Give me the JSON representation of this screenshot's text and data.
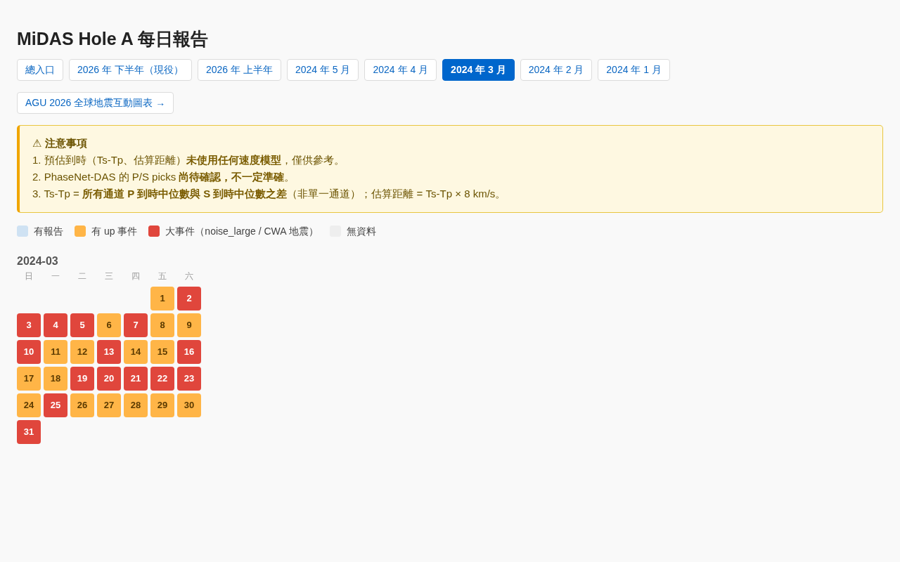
{
  "title": "MiDAS Hole A 每日報告",
  "nav": [
    {
      "label": "總入口",
      "selected": false
    },
    {
      "label": "2026 年 下半年（現役）",
      "selected": false
    },
    {
      "label": "2026 年 上半年",
      "selected": false
    },
    {
      "label": "2024 年 5 月",
      "selected": false
    },
    {
      "label": "2024 年 4 月",
      "selected": false
    },
    {
      "label": "2024 年 3 月",
      "selected": true
    },
    {
      "label": "2024 年 2 月",
      "selected": false
    },
    {
      "label": "2024 年 1 月",
      "selected": false
    }
  ],
  "link": "AGU 2026 全球地震互動圖表 →",
  "notice": {
    "title": "⚠ 注意事項",
    "lines": [
      "1. 預估到時（Ts-Tp、估算距離）**未使用任何速度模型**，僅供參考。",
      "2. PhaseNet-DAS 的 P/S picks **尚待確認，不一定準確**。",
      "3. Ts-Tp = **所有通道 P 到時中位數與 S 到時中位數之差**（非單一通道）；估算距離 = Ts-Tp × 8 km/s。"
    ]
  },
  "legend": [
    {
      "label": "有報告",
      "color": "#cfe2f3"
    },
    {
      "label": "有 up 事件",
      "color": "#ffb547"
    },
    {
      "label": "大事件（noise_large / CWA 地震）",
      "color": "#e0463c"
    },
    {
      "label": "無資料",
      "color": "#eeeeee"
    }
  ],
  "calendar": {
    "month": "2024-03",
    "weekdays": [
      "日",
      "一",
      "二",
      "三",
      "四",
      "五",
      "六"
    ],
    "days": [
      {
        "label": "1",
        "kind": "up"
      },
      {
        "label": "2",
        "kind": "big"
      },
      {
        "label": "3",
        "kind": "big"
      },
      {
        "label": "4",
        "kind": "big"
      },
      {
        "label": "5",
        "kind": "big"
      },
      {
        "label": "6",
        "kind": "up"
      },
      {
        "label": "7",
        "kind": "big"
      },
      {
        "label": "8",
        "kind": "up"
      },
      {
        "label": "9",
        "kind": "up"
      },
      {
        "label": "10",
        "kind": "big"
      },
      {
        "label": "11",
        "kind": "up"
      },
      {
        "label": "12",
        "kind": "up"
      },
      {
        "label": "13",
        "kind": "big"
      },
      {
        "label": "14",
        "kind": "up"
      },
      {
        "label": "15",
        "kind": "up"
      },
      {
        "label": "16",
        "kind": "big"
      },
      {
        "label": "17",
        "kind": "up"
      },
      {
        "label": "18",
        "kind": "up"
      },
      {
        "label": "19",
        "kind": "big"
      },
      {
        "label": "20",
        "kind": "big"
      },
      {
        "label": "21",
        "kind": "big"
      },
      {
        "label": "22",
        "kind": "big"
      },
      {
        "label": "23",
        "kind": "big"
      },
      {
        "label": "24",
        "kind": "up"
      },
      {
        "label": "25",
        "kind": "big"
      },
      {
        "label": "26",
        "kind": "up"
      },
      {
        "label": "27",
        "kind": "up"
      },
      {
        "label": "28",
        "kind": "up"
      },
      {
        "label": "29",
        "kind": "up"
      },
      {
        "label": "30",
        "kind": "up"
      },
      {
        "label": "31",
        "kind": "big"
      }
    ]
  }
}
